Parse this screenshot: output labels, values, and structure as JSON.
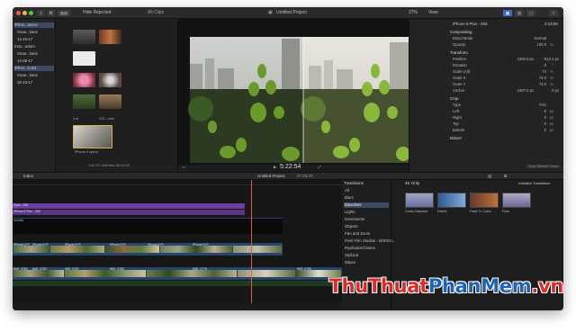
{
  "titlebar": {
    "library_filter": "Hide Rejected",
    "clip_filter": "All Clips",
    "project_title": "Untitled Project",
    "zoom": "27%",
    "view_label": "View",
    "inspector_title": "iPhone 6 Plus - 393",
    "inspector_time": "2:19:59"
  },
  "library": {
    "items": [
      {
        "label": "iPhon...aview",
        "selected": true
      },
      {
        "label": "Smar...tions",
        "selected": false
      },
      {
        "label": "14-10-17",
        "selected": false
      },
      {
        "label": "Inno...edom",
        "selected": false
      },
      {
        "label": "Smar...tions",
        "selected": false
      },
      {
        "label": "14-08-17",
        "selected": false
      },
      {
        "label": "iPhon...6 dot",
        "selected": true
      },
      {
        "label": "Smar...tions",
        "selected": false
      },
      {
        "label": "16-10-17",
        "selected": false
      }
    ]
  },
  "browser": {
    "thumb_labels": [
      "1 m",
      "232...ures",
      "iPhone 6 specs"
    ],
    "status": "1 of 107 selected, 00:01:09"
  },
  "viewer": {
    "timecode": "5:22:54",
    "in_label": "In",
    "out_label": "Out"
  },
  "inspector": {
    "sections": {
      "compositing": "Compositing",
      "transform": "Transform",
      "crop": "Crop",
      "distort": "Distort"
    },
    "rows": [
      {
        "label": "Blend Mode",
        "value": "Normal",
        "unit": ""
      },
      {
        "label": "Opacity",
        "value": "100.0",
        "unit": "%"
      },
      {
        "label": "Position",
        "value": "1050.9 px",
        "unit": "-514.4 px"
      },
      {
        "label": "Rotation",
        "value": "0",
        "unit": "°"
      },
      {
        "label": "Scale (All)",
        "value": "74",
        "unit": "%"
      },
      {
        "label": "Scale X",
        "value": "74.0",
        "unit": "%"
      },
      {
        "label": "Scale Y",
        "value": "74.0",
        "unit": "%"
      },
      {
        "label": "Anchor",
        "value": "1997.0 px",
        "unit": "0 px"
      },
      {
        "label": "Type",
        "value": "Trim",
        "unit": ""
      },
      {
        "label": "Left",
        "value": "0",
        "unit": "px"
      },
      {
        "label": "Right",
        "value": "0",
        "unit": "px"
      },
      {
        "label": "Top",
        "value": "0",
        "unit": "px"
      },
      {
        "label": "Bottom",
        "value": "0",
        "unit": "px"
      }
    ],
    "save_label": "Save Effects Preset"
  },
  "timeline_bar": {
    "index_label": "Index",
    "project": "Untitled Project",
    "duration": "07:25:10"
  },
  "timeline": {
    "title_clips": [
      "Styla - 480",
      "iPhone 6 Plus - 393"
    ],
    "subtitle_clip": "Subtitle",
    "video_labels": [
      "iPhone 6 Pl",
      "iPhone 6 Pl",
      "iPhone 6 Pl",
      "iPhone 6 Pl",
      "iPhone 6 Pl",
      "iPhone 6 Pl"
    ],
    "audio_labels": [
      "IMG_0781",
      "IMG_0783",
      "IMG_0787",
      "IMG_0782",
      "IMG_0776",
      "IMG_0790"
    ]
  },
  "transitions": {
    "header": "Transitions",
    "filter": "4K Only",
    "installed": "Installed Transitions",
    "categories": [
      {
        "label": "All",
        "selected": false
      },
      {
        "label": "Blurs",
        "selected": false
      },
      {
        "label": "Dissolves",
        "selected": true
      },
      {
        "label": "Lights",
        "selected": false
      },
      {
        "label": "Movements",
        "selected": false
      },
      {
        "label": "Objects",
        "selected": false
      },
      {
        "label": "Pan and Zoom",
        "selected": false
      },
      {
        "label": "Pixel Film Studios - BOKEH...",
        "selected": false
      },
      {
        "label": "Replicator/Clones",
        "selected": false
      },
      {
        "label": "Stylized",
        "selected": false
      },
      {
        "label": "Wipes",
        "selected": false
      }
    ],
    "tiles": [
      {
        "label": "Cross Dissolve",
        "color": "#8e94b8"
      },
      {
        "label": "Divide",
        "color": "#4e77b5"
      },
      {
        "label": "Fade To Color",
        "color": "#a4613b"
      },
      {
        "label": "Flow",
        "color": "#8d86a6"
      }
    ]
  },
  "watermark": {
    "part1": "ThuThuat",
    "part2": "PhanMem",
    "part3": ".vn"
  },
  "colors": {
    "accent": "#3d6bc8",
    "playhead": "#e05a4a",
    "title_clip": "#6b3fa0",
    "watermark_red": "#d82b2b",
    "watermark_blue": "#1e63b8"
  }
}
